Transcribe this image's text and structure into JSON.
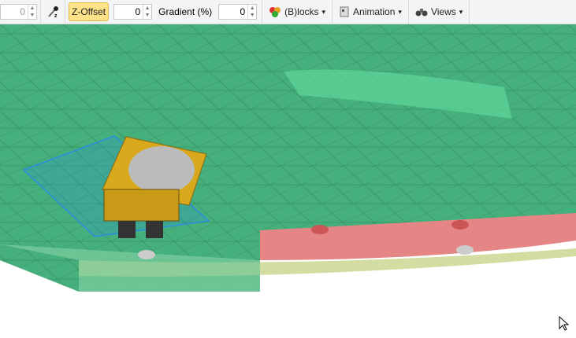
{
  "toolbar": {
    "first_value": "0",
    "z_offset_label": "Z-Offset",
    "z_offset_value": "0",
    "gradient_label": "Gradient (%)",
    "gradient_value": "0",
    "blocks_label": "(B)locks",
    "animation_label": "Animation",
    "views_label": "Views",
    "dropdown_arrow": "▾",
    "spin_up": "▲",
    "spin_down": "▼"
  },
  "colors": {
    "surface": "#3fae78",
    "road": "#e07a7a",
    "truck": "#d9a81c",
    "selection": "#2a8ee0",
    "toolbar": "#f3f4f5"
  }
}
